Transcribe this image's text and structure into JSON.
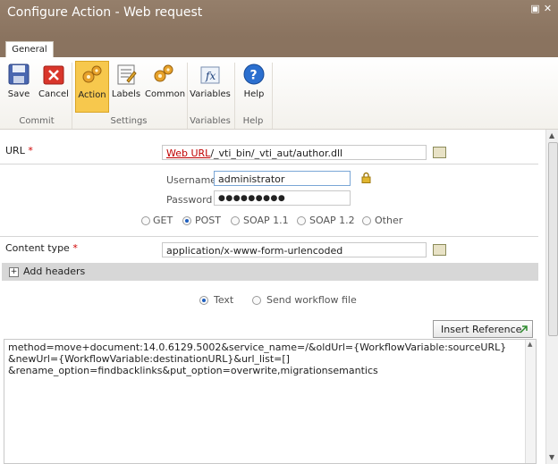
{
  "window": {
    "title": "Configure Action - Web request"
  },
  "ribbon": {
    "tab": "General",
    "buttons": {
      "save": "Save",
      "cancel": "Cancel",
      "action": "Action",
      "labels": "Labels",
      "common": "Common",
      "variables": "Variables",
      "help": "Help"
    },
    "groups": {
      "commit": "Commit",
      "settings": "Settings",
      "variables": "Variables",
      "help": "Help"
    }
  },
  "form": {
    "url_label": "URL",
    "required_mark": "*",
    "url_token": "Web URL",
    "url_rest": "/_vti_bin/_vti_aut/author.dll",
    "username_label": "Username",
    "username_value": "administrator",
    "password_label": "Password",
    "password_value": "●●●●●●●●●",
    "methods": [
      "GET",
      "POST",
      "SOAP 1.1",
      "SOAP 1.2",
      "Other"
    ],
    "selected_method": "POST",
    "content_type_label": "Content type",
    "content_type_value": "application/x-www-form-urlencoded",
    "add_headers": "Add headers",
    "body_modes": [
      "Text",
      "Send workflow file"
    ],
    "selected_body_mode": "Text",
    "insert_reference": "Insert Reference",
    "body_text": "method=move+document:14.0.6129.5002&service_name=/&oldUrl={WorkflowVariable:sourceURL}\n&newUrl={WorkflowVariable:destinationURL}&url_list=[]\n&rename_option=findbacklinks&put_option=overwrite,migrationsemantics"
  },
  "colors": {
    "title_bar": "#8a735f",
    "active_button": "#f7c84d",
    "required": "#d00000",
    "radio_selected": "#1f5fbf",
    "header_band": "#d7d7d7"
  }
}
